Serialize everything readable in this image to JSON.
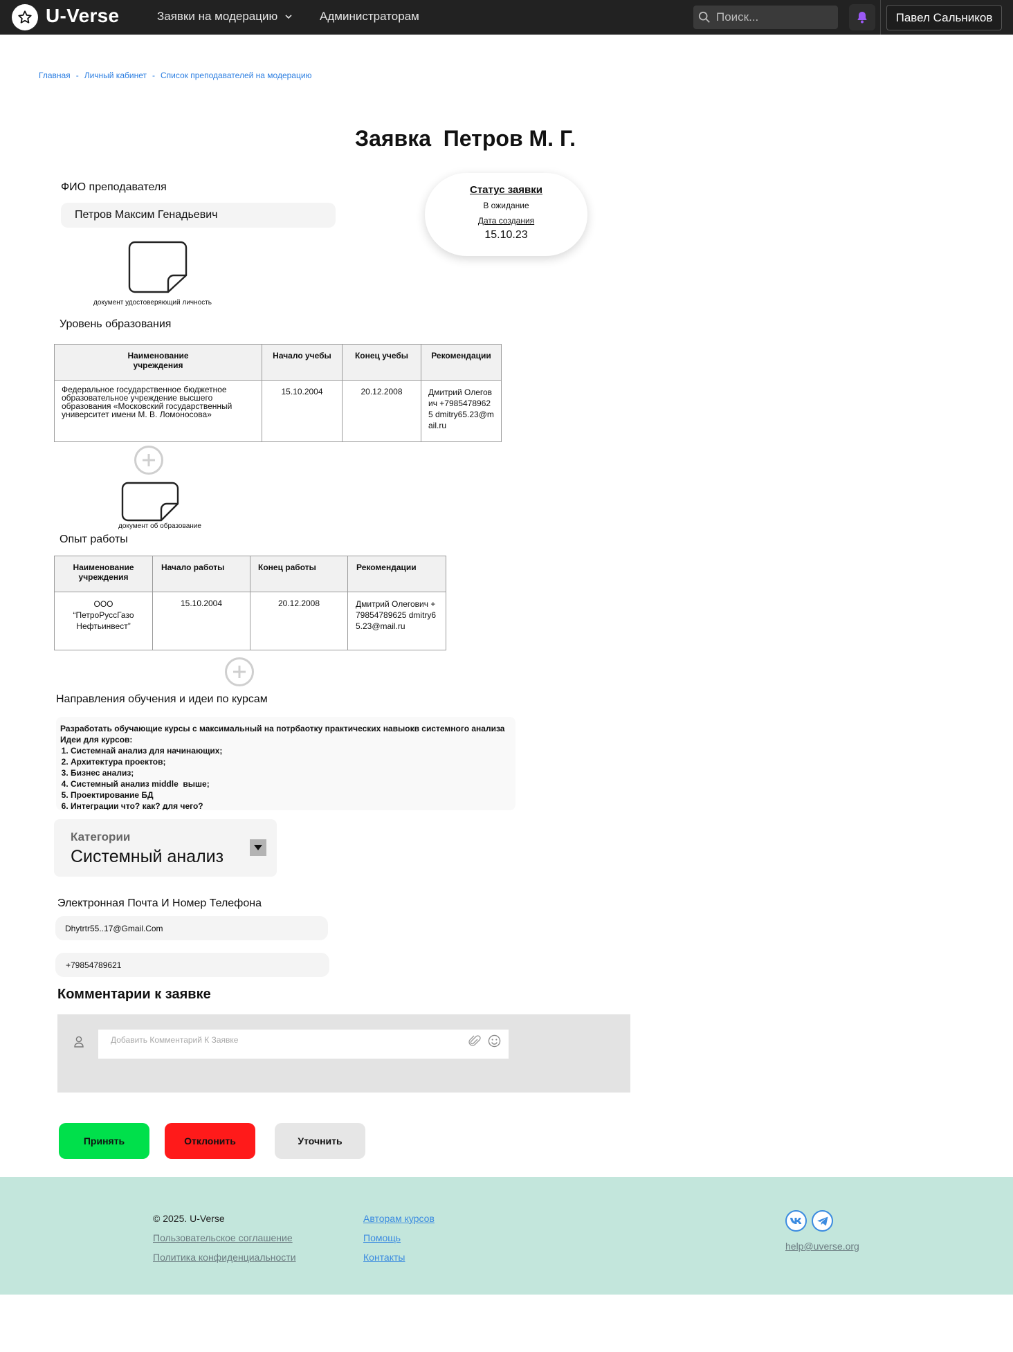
{
  "header": {
    "brand": "U-Verse",
    "nav_moderation": "Заявки на модерацию",
    "nav_admins": "Администраторам",
    "search_placeholder": "Поиск...",
    "user_name": "Павел Сальников",
    "accent_color": "#9b59f5"
  },
  "breadcrumb": {
    "items": [
      "Главная",
      "Личный кабинет",
      "Список преподавателей на модерацию"
    ],
    "separator": "-"
  },
  "page_title": "Заявка  Петров М. Г.",
  "teacher": {
    "label": "ФИО преподавателя",
    "value": "Петров Максим Генадьевич",
    "id_doc_caption": "документ удостоверяющий личность"
  },
  "status": {
    "title": "Статус заявки",
    "value": "В ожидание",
    "date_label": "Дата создания",
    "date": "15.10.23"
  },
  "education": {
    "label": "Уровень образования",
    "headers": [
      "Наименование учреждения",
      "Начало учебы",
      "Конец учебы",
      "Рекомендации"
    ],
    "rows": [
      {
        "institution": "Федеральное государственное бюджетное образовательное учреждение высшего образования «Московский государственный университет имени М. В. Ломоносова»",
        "start": "15.10.2004",
        "end": "20.12.2008",
        "recommendation": "Дмитрий Олегович +79854789625 dmitry65.23@mail.ru"
      }
    ],
    "doc_caption": "документ об образование"
  },
  "work": {
    "label": "Опыт работы",
    "headers": [
      "Наименование учреждения",
      "Начало работы",
      "Конец работы",
      "Рекомендации"
    ],
    "rows": [
      {
        "institution": "ООО “ПетроРуссГазо Нефтьинвест”",
        "start": "15.10.2004",
        "end": "20.12.2008",
        "recommendation": "Дмитрий Олегович +79854789625 dmitry65.23@mail.ru"
      }
    ]
  },
  "ideas": {
    "label": "Направления обучения и идеи по курсам",
    "intro": "Разработать обучающие курсы с максимальный на потрбаотку практических навыокв системного анализа",
    "list_title": "Идеи для курсов:",
    "items": [
      "Системнай анализ для начинающих;",
      "Архитектура проектов;",
      "Бизнес анализ;",
      "Системный анализ middle  выше;",
      "Проектирование БД",
      "Интеграции что? как? для чего?"
    ]
  },
  "category": {
    "label": "Категории",
    "value": "Системный анализ"
  },
  "contacts": {
    "label": "Электронная Почта И Номер Телефона",
    "email": "Dhytrtr55..17@Gmail.Com",
    "phone": "+79854789621"
  },
  "comments": {
    "title": "Комментарии к заявке",
    "placeholder": "Добавить Комментарий К Заявке"
  },
  "actions": {
    "accept": "Принять",
    "reject": "Отклонить",
    "clarify": "Уточнить",
    "accept_color": "#00e04b",
    "reject_color": "#ff1a1a",
    "clarify_color": "#e6e6e6"
  },
  "footer": {
    "copyright": "© 2025. U-Verse",
    "terms": "Пользовательское соглашение",
    "privacy": "Политика конфиденциальности",
    "authors": "Авторам курсов",
    "help": "Помощь",
    "contacts": "Контакты",
    "email": "help@uverse.org",
    "bg_color": "#c3e6dc"
  }
}
